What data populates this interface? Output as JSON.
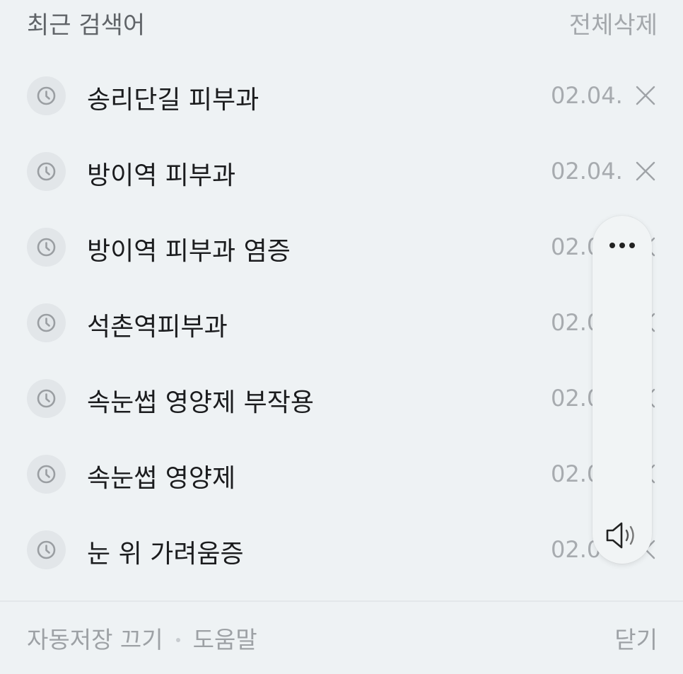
{
  "header": {
    "title": "최근 검색어",
    "clear_all": "전체삭제"
  },
  "recent_searches": [
    {
      "query": "송리단길 피부과",
      "date": "02.04."
    },
    {
      "query": "방이역 피부과",
      "date": "02.04."
    },
    {
      "query": "방이역 피부과 염증",
      "date": "02.0"
    },
    {
      "query": "석촌역피부과",
      "date": "02.0"
    },
    {
      "query": "속눈썹 영양제 부작용",
      "date": "02.0"
    },
    {
      "query": "속눈썹 영양제",
      "date": "02.0"
    },
    {
      "query": "눈 위 가려움증",
      "date": "02.0"
    }
  ],
  "footer": {
    "autosave_off": "자동저장 끄기",
    "help": "도움말",
    "close": "닫기"
  },
  "icons": {
    "row_icon": "clock-icon",
    "row_delete": "close-icon",
    "float_menu": "more-horizontal-icon",
    "float_audio": "speaker-icon"
  },
  "colors": {
    "background": "#eef2f4",
    "text_primary": "#1b1c1e",
    "text_muted": "#a7abaf"
  }
}
